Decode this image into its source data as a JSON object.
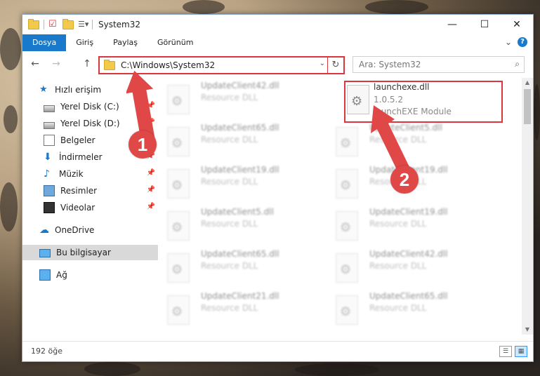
{
  "window": {
    "title": "System32",
    "controls": {
      "minimize": "—",
      "maximize": "☐",
      "close": "✕"
    }
  },
  "ribbon": {
    "tabs": [
      "Dosya",
      "Giriş",
      "Paylaş",
      "Görünüm"
    ],
    "expand": "⌄",
    "help": "?"
  },
  "address": {
    "path": "C:\\Windows\\System32",
    "dropdown": "⌄",
    "refresh": "↻"
  },
  "search": {
    "placeholder": "Ara: System32"
  },
  "navigation": {
    "back": "←",
    "forward": "→",
    "up": "↑",
    "items": [
      {
        "label": "Hızlı erişim",
        "icon": "star-icon",
        "pinned": false
      },
      {
        "label": "Yerel Disk (C:)",
        "icon": "drive-icon",
        "pinned": true
      },
      {
        "label": "Yerel Disk (D:)",
        "icon": "drive-icon",
        "pinned": true
      },
      {
        "label": "Belgeler",
        "icon": "documents-icon",
        "pinned": true
      },
      {
        "label": "İndirmeler",
        "icon": "download-icon",
        "pinned": true
      },
      {
        "label": "Müzik",
        "icon": "music-icon",
        "pinned": true
      },
      {
        "label": "Resimler",
        "icon": "pictures-icon",
        "pinned": true
      },
      {
        "label": "Videolar",
        "icon": "video-icon",
        "pinned": true
      },
      {
        "label": "OneDrive",
        "icon": "cloud-icon",
        "pinned": false
      },
      {
        "label": "Bu bilgisayar",
        "icon": "computer-icon",
        "pinned": false,
        "selected": true
      },
      {
        "label": "Ağ",
        "icon": "network-icon",
        "pinned": false
      }
    ]
  },
  "files": {
    "left_column": [
      {
        "name": "UpdateClient42.dll",
        "type": "Resource DLL"
      },
      {
        "name": "UpdateClient65.dll",
        "type": "Resource DLL"
      },
      {
        "name": "UpdateClient19.dll",
        "type": "Resource DLL"
      },
      {
        "name": "UpdateClient5.dll",
        "type": "Resource DLL"
      },
      {
        "name": "UpdateClient65.dll",
        "type": "Resource DLL"
      },
      {
        "name": "UpdateClient21.dll",
        "type": "Resource DLL"
      }
    ],
    "highlighted": {
      "name": "launchexe.dll",
      "version": "1.0.5.2",
      "description": "launchEXE Module"
    },
    "right_column": [
      {
        "name": "UpdateClient5.dll",
        "type": "Resource DLL"
      },
      {
        "name": "UpdateClient19.dll",
        "type": "Resource DLL"
      },
      {
        "name": "UpdateClient19.dll",
        "type": "Resource DLL"
      },
      {
        "name": "UpdateClient42.dll",
        "type": "Resource DLL"
      },
      {
        "name": "UpdateClient65.dll",
        "type": "Resource DLL"
      }
    ]
  },
  "status": {
    "item_count": "192 öğe"
  },
  "annotations": {
    "step1": "1",
    "step2": "2",
    "arrow_color": "#e04848"
  }
}
